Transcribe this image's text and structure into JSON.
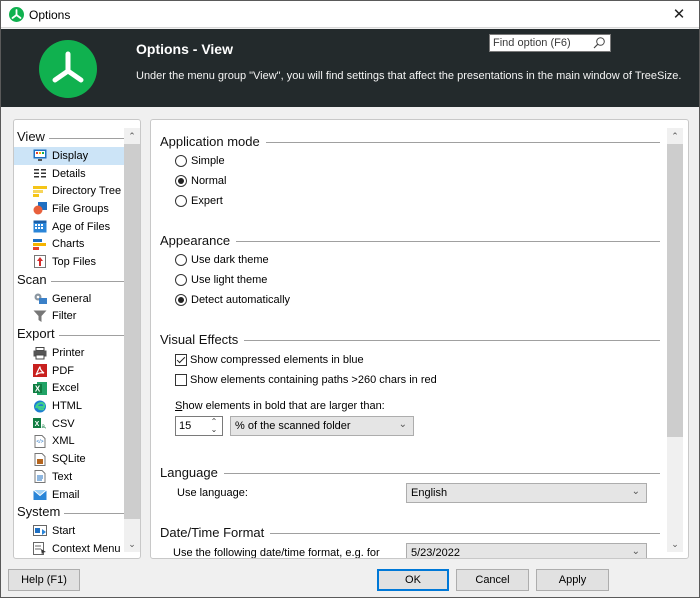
{
  "window": {
    "title": "Options",
    "close_glyph": "✕"
  },
  "header": {
    "title": "Options - View",
    "description": "Under the menu group \"View\", you will find settings that affect the presentations in the main window of TreeSize.",
    "search_placeholder": "Find option (F6)"
  },
  "nav": {
    "groups": [
      {
        "label": "View",
        "items": [
          {
            "label": "Display",
            "icon": "display-icon",
            "selected": true
          },
          {
            "label": "Details",
            "icon": "details-icon"
          },
          {
            "label": "Directory Tree",
            "icon": "directory-tree-icon"
          },
          {
            "label": "File Groups",
            "icon": "file-groups-icon"
          },
          {
            "label": "Age of Files",
            "icon": "calendar-icon"
          },
          {
            "label": "Charts",
            "icon": "charts-icon"
          },
          {
            "label": "Top Files",
            "icon": "top-files-icon"
          }
        ]
      },
      {
        "label": "Scan",
        "items": [
          {
            "label": "General",
            "icon": "gear-icon"
          },
          {
            "label": "Filter",
            "icon": "filter-icon"
          }
        ]
      },
      {
        "label": "Export",
        "items": [
          {
            "label": "Printer",
            "icon": "printer-icon"
          },
          {
            "label": "PDF",
            "icon": "pdf-icon"
          },
          {
            "label": "Excel",
            "icon": "excel-icon"
          },
          {
            "label": "HTML",
            "icon": "html-icon"
          },
          {
            "label": "CSV",
            "icon": "csv-icon"
          },
          {
            "label": "XML",
            "icon": "xml-icon"
          },
          {
            "label": "SQLite",
            "icon": "sqlite-icon"
          },
          {
            "label": "Text",
            "icon": "text-file-icon"
          },
          {
            "label": "Email",
            "icon": "email-icon"
          }
        ]
      },
      {
        "label": "System",
        "items": [
          {
            "label": "Start",
            "icon": "start-icon"
          },
          {
            "label": "Context Menu",
            "icon": "context-menu-icon"
          }
        ]
      }
    ],
    "scroll_position": 0
  },
  "content": {
    "application_mode": {
      "title": "Application mode",
      "options": [
        "Simple",
        "Normal",
        "Expert"
      ],
      "selected": "Normal"
    },
    "appearance": {
      "title": "Appearance",
      "options": [
        "Use dark theme",
        "Use light theme",
        "Detect automatically"
      ],
      "selected": "Detect automatically"
    },
    "visual_effects": {
      "title": "Visual Effects",
      "compressed_blue": {
        "label": "Show compressed elements in blue",
        "checked": true
      },
      "long_paths_red": {
        "label": "Show elements containing paths >260 chars in red",
        "checked": false
      },
      "bold_label_accel": "S",
      "bold_label_rest": "how elements in bold that are larger than:",
      "bold_threshold_value": "15",
      "bold_unit_selected": "% of the scanned folder"
    },
    "language": {
      "title": "Language",
      "label": "Use language:",
      "selected": "English"
    },
    "datetime": {
      "title": "Date/Time Format",
      "label": "Use the following date/time format, e.g. for",
      "selected": "5/23/2022"
    },
    "scroll_position": 0
  },
  "buttons": {
    "help": "Help (F1)",
    "ok": "OK",
    "cancel": "Cancel",
    "apply": "Apply"
  },
  "colors": {
    "brand_green": "#10b14f",
    "header_bg": "#232a2c",
    "selection": "#cce4f7",
    "default_button_border": "#0078d7"
  }
}
